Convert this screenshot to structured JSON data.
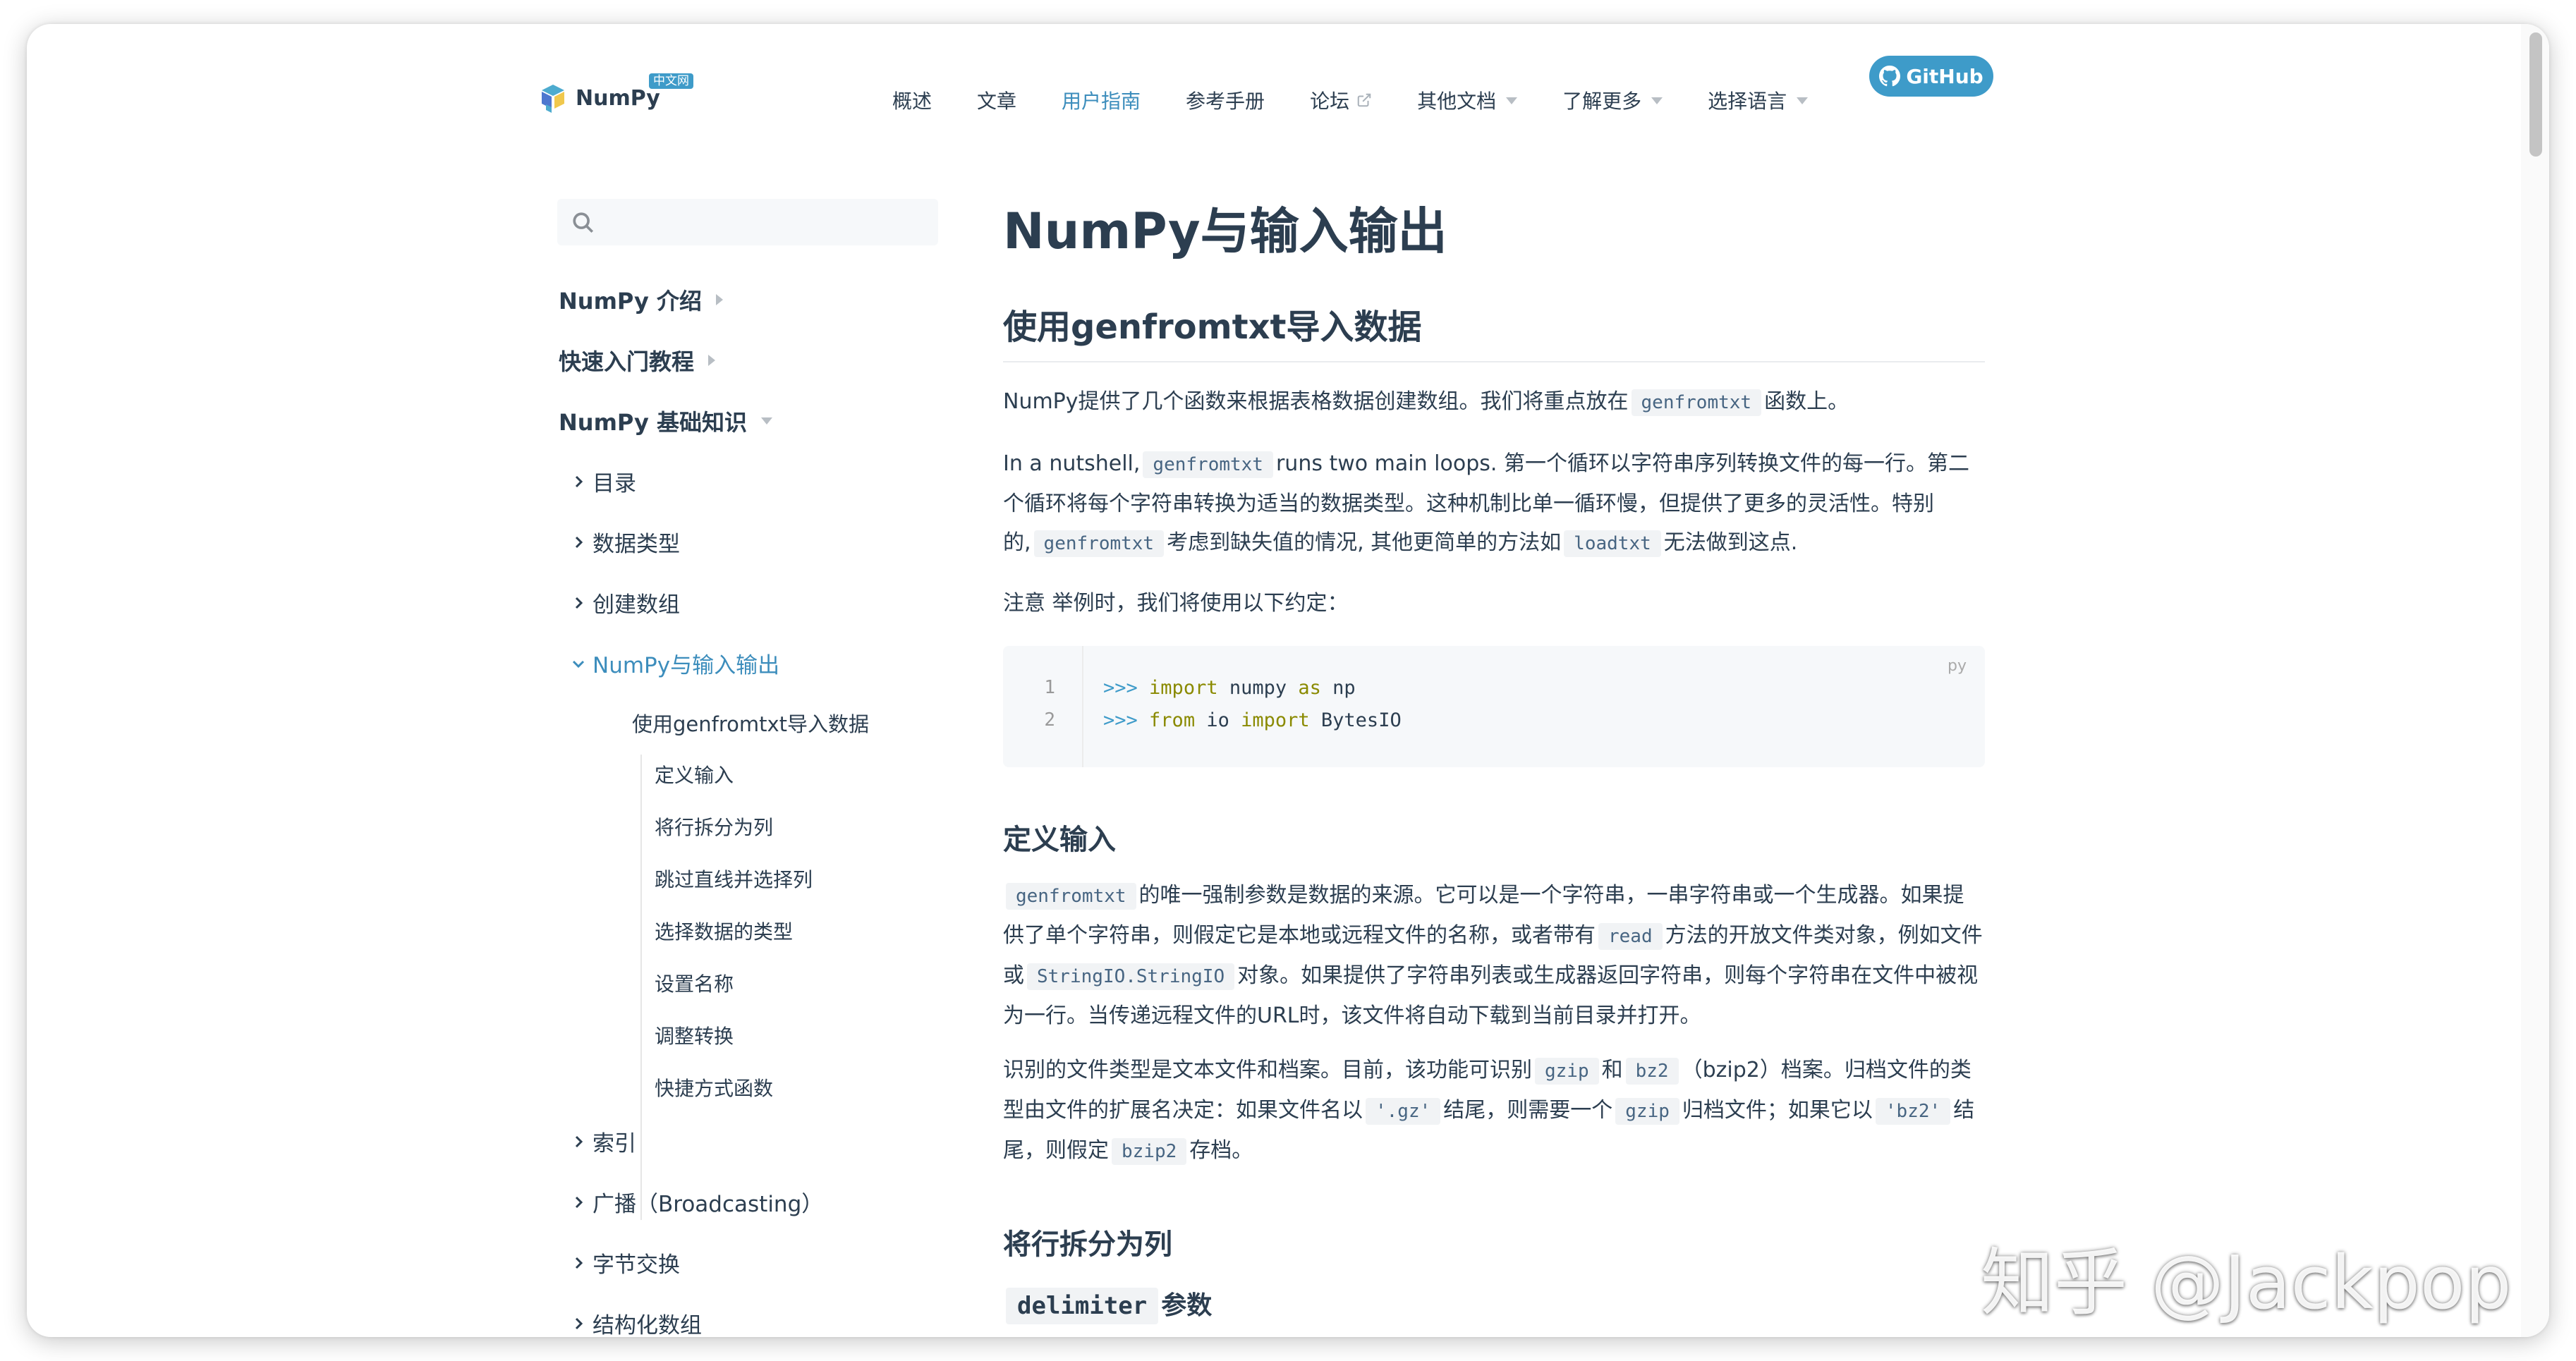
{
  "header": {
    "logo_text": "NumPy",
    "logo_badge": "中文网",
    "nav": [
      {
        "label": "概述"
      },
      {
        "label": "文章"
      },
      {
        "label": "用户指南"
      },
      {
        "label": "参考手册"
      },
      {
        "label": "论坛"
      },
      {
        "label": "其他文档"
      },
      {
        "label": "了解更多"
      },
      {
        "label": "选择语言"
      }
    ],
    "github_label": "GitHub",
    "accent_color": "#3e9bc9"
  },
  "search": {
    "placeholder": "",
    "value": ""
  },
  "sidebar": {
    "top": [
      {
        "label": "NumPy 介绍"
      },
      {
        "label": "快速入门教程"
      },
      {
        "label": "NumPy 基础知识"
      }
    ],
    "sections": [
      {
        "label": "目录"
      },
      {
        "label": "数据类型"
      },
      {
        "label": "创建数组"
      },
      {
        "label": "NumPy与输入输出"
      },
      {
        "label": "索引"
      },
      {
        "label": "广播（Broadcasting）"
      },
      {
        "label": "字节交换"
      },
      {
        "label": "结构化数组"
      }
    ],
    "sub": "使用genfromtxt导入数据",
    "subsub": [
      "定义输入",
      "将行拆分为列",
      "跳过直线并选择列",
      "选择数据的类型",
      "设置名称",
      "调整转换",
      "快捷方式函数"
    ]
  },
  "content": {
    "title": "NumPy与输入输出",
    "h2": "使用genfromtxt导入数据",
    "p1": {
      "a": "NumPy提供了几个函数来根据表格数据创建数组。我们将重点放在",
      "code1": "genfromtxt",
      "b": "函数上。"
    },
    "p2": {
      "a": "In a nutshell,",
      "code1": "genfromtxt",
      "b": "runs two main loops. 第一个循环以字符串序列转换文件的每一行。第二个循环将每个字符串转换为适当的数据类型。这种机制比单一循环慢，但提供了更多的灵活性。特别的,",
      "code2": "genfromtxt",
      "c": "考虑到缺失值的情况, 其他更简单的方法如",
      "code3": "loadtxt",
      "d": "无法做到这点."
    },
    "p3": "注意 举例时，我们将使用以下约定：",
    "code_block": {
      "lang": "py",
      "lines": [
        {
          "num": "1",
          "prompt": ">>>",
          "k1": "import",
          "t1": " numpy ",
          "k2": "as",
          "t2": " np"
        },
        {
          "num": "2",
          "prompt": ">>>",
          "k1": "from",
          "t1": " io ",
          "k2": "import",
          "t2": " BytesIO"
        }
      ]
    },
    "h3a": "定义输入",
    "p4": {
      "code1": "genfromtxt",
      "a": "的唯一强制参数是数据的来源。它可以是一个字符串，一串字符串或一个生成器。如果提供了单个字符串，则假定它是本地或远程文件的名称，或者带有",
      "code2": "read",
      "b": "方法的开放文件类对象，例如文件或",
      "code3": "StringIO.StringIO",
      "c": "对象。如果提供了字符串列表或生成器返回字符串，则每个字符串在文件中被视为一行。当传递远程文件的URL时，该文件将自动下载到当前目录并打开。"
    },
    "p5": {
      "a": "识别的文件类型是文本文件和档案。目前，该功能可识别",
      "code1": "gzip",
      "b": "和",
      "code2": "bz2",
      "c": "（bzip2）档案。归档文件的类型由文件的扩展名决定：如果文件名以",
      "code3": "'.gz'",
      "d": "结尾，则需要一个",
      "code4": "gzip",
      "e": "归档文件；如果它以",
      "code5": "'bz2'",
      "f": "结尾，则假定",
      "code6": "bzip2",
      "g": "存档。"
    },
    "h3b": "将行拆分为列",
    "h4": {
      "code": "delimiter",
      "text": "参数"
    }
  },
  "watermark": "知乎 @Jackpop"
}
